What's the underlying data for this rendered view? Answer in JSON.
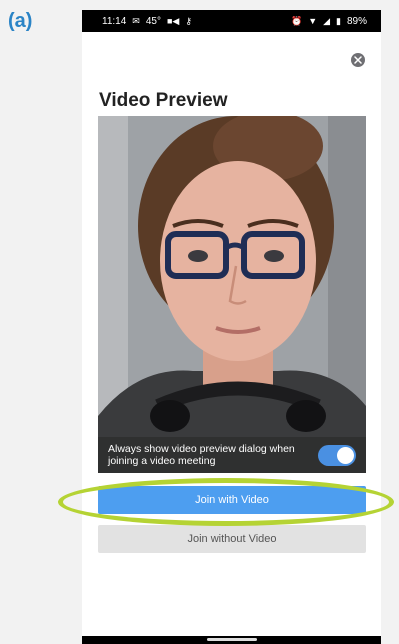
{
  "figure_label": "(a)",
  "status_bar": {
    "time": "11:14",
    "temp": "45°",
    "battery": "89%"
  },
  "dialog": {
    "title": "Video Preview",
    "preview_option_text": "Always show video preview dialog when joining a video meeting",
    "toggle_on": true,
    "join_with_video_label": "Join with Video",
    "join_without_video_label": "Join without Video"
  },
  "colors": {
    "primary_button": "#4d9ef0",
    "secondary_button": "#e2e2e2",
    "toggle": "#4a90e2",
    "highlight": "#b5d334",
    "figure_label": "#2b84c6"
  }
}
